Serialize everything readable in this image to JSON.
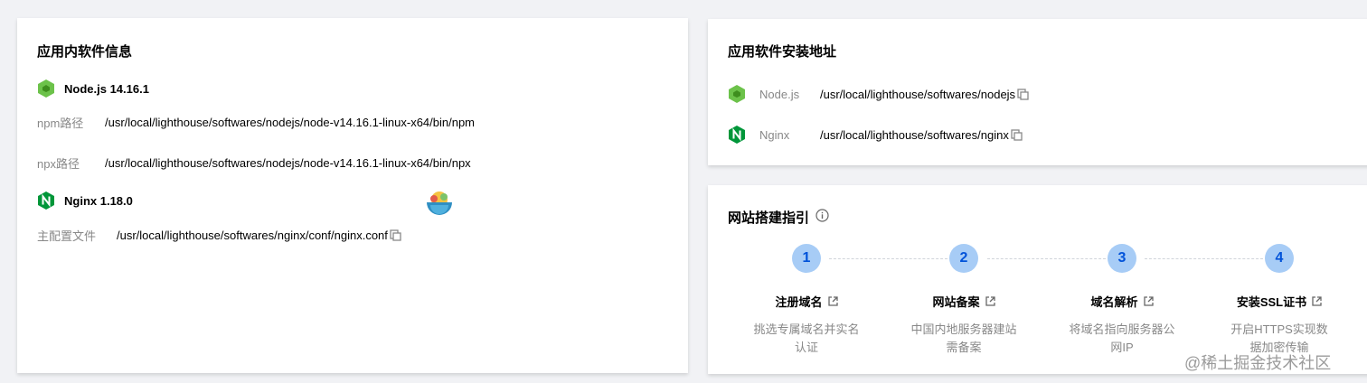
{
  "software_card": {
    "title": "应用内软件信息",
    "node": {
      "name": "Node.js 14.16.1",
      "npm_label": "npm路径",
      "npm_path": "/usr/local/lighthouse/softwares/nodejs/node-v14.16.1-linux-x64/bin/npm",
      "npx_label": "npx路径",
      "npx_path": "/usr/local/lighthouse/softwares/nodejs/node-v14.16.1-linux-x64/bin/npx"
    },
    "nginx": {
      "name": "Nginx 1.18.0",
      "conf_label": "主配置文件",
      "conf_path": "/usr/local/lighthouse/softwares/nginx/conf/nginx.conf"
    }
  },
  "address_card": {
    "title": "应用软件安装地址",
    "items": [
      {
        "name": "Node.js",
        "path": "/usr/local/lighthouse/softwares/nodejs",
        "icon": "nodejs-icon"
      },
      {
        "name": "Nginx",
        "path": "/usr/local/lighthouse/softwares/nginx",
        "icon": "nginx-icon"
      }
    ]
  },
  "guide_card": {
    "title": "网站搭建指引",
    "steps": [
      {
        "num": "1",
        "title": "注册域名",
        "desc": "挑选专属域名并实名认证"
      },
      {
        "num": "2",
        "title": "网站备案",
        "desc": "中国内地服务器建站需备案"
      },
      {
        "num": "3",
        "title": "域名解析",
        "desc": "将域名指向服务器公网IP"
      },
      {
        "num": "4",
        "title": "安装SSL证书",
        "desc": "开启HTTPS实现数据加密传输"
      }
    ]
  },
  "watermark": "@稀土掘金技术社区",
  "colors": {
    "accent": "#0052d9",
    "step_bg": "#a7ccf6",
    "node_green": "#6cc24a",
    "nginx_green": "#009639"
  }
}
